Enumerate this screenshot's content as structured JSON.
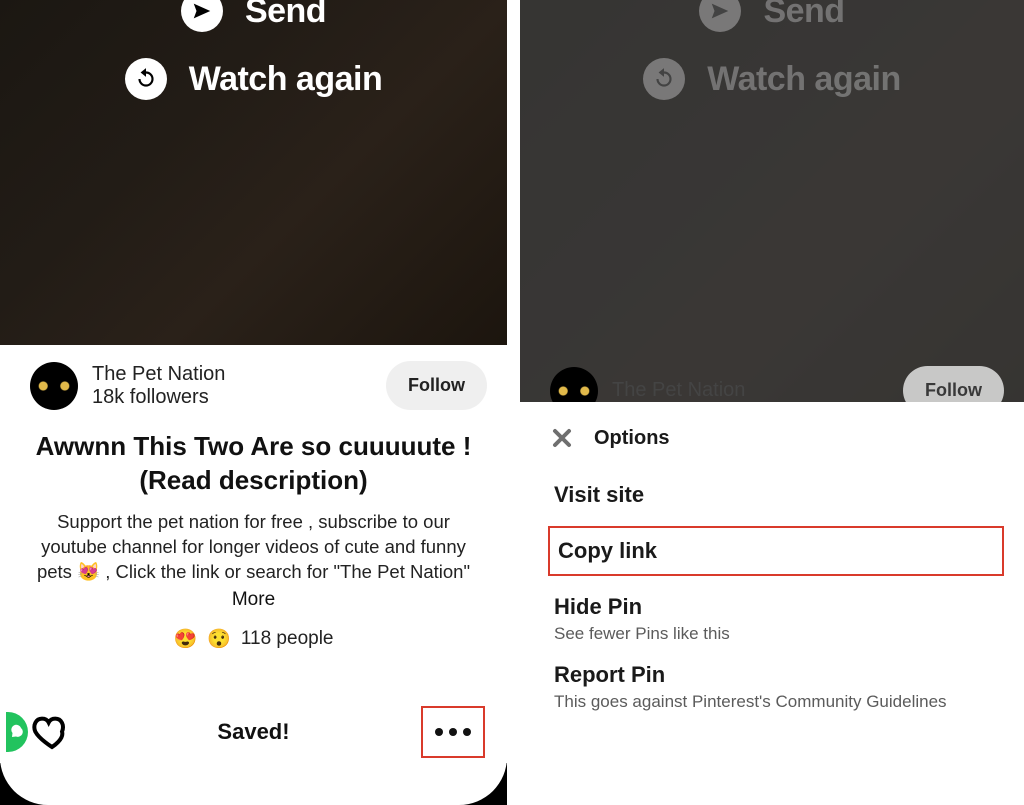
{
  "left": {
    "video": {
      "send_label": "Send",
      "watch_again_label": "Watch again"
    },
    "creator": {
      "name": "The Pet Nation",
      "followers": "18k followers",
      "follow_button": "Follow"
    },
    "post": {
      "title": "Awwnn This Two Are so cuuuuute ! (Read description)",
      "description": "Support the pet nation for free , subscribe to our youtube channel for longer videos of cute and funny pets 😻 , Click the link or search for \"The Pet Nation\"",
      "more_label": "More",
      "reactions_count": "118 people"
    },
    "bottom": {
      "saved_label": "Saved!"
    }
  },
  "right": {
    "video": {
      "send_label": "Send",
      "watch_again_label": "Watch again"
    },
    "creator": {
      "name": "The Pet Nation",
      "follow_button": "Follow"
    },
    "sheet": {
      "title": "Options",
      "items": {
        "visit": {
          "label": "Visit site"
        },
        "copy": {
          "label": "Copy link"
        },
        "hide": {
          "label": "Hide Pin",
          "sub": "See fewer Pins like this"
        },
        "report": {
          "label": "Report Pin",
          "sub": "This goes against Pinterest's Community Guidelines"
        }
      }
    }
  }
}
